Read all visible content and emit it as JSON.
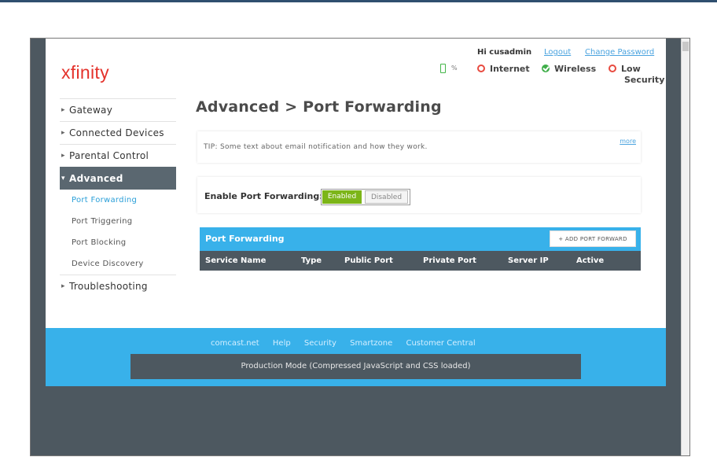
{
  "brand": {
    "logo": "xfinity",
    "accent": "#e4322b",
    "blue": "#38b1ea",
    "green": "#7cb518"
  },
  "header": {
    "greeting": "Hi cusadmin",
    "logout": "Logout",
    "change_password": "Change Password",
    "battery_pct": "%",
    "status": {
      "internet": "Internet",
      "wireless": "Wireless",
      "security_line1": "Low",
      "security_line2": "Security"
    }
  },
  "sidebar": {
    "items": [
      {
        "label": "Gateway"
      },
      {
        "label": "Connected Devices"
      },
      {
        "label": "Parental Control"
      },
      {
        "label": "Advanced"
      },
      {
        "label": "Troubleshooting"
      }
    ],
    "sub_items": [
      {
        "label": "Port Forwarding"
      },
      {
        "label": "Port Triggering"
      },
      {
        "label": "Port Blocking"
      },
      {
        "label": "Device Discovery"
      }
    ]
  },
  "main": {
    "title": "Advanced > Port Forwarding",
    "tip": "TIP: Some text about email notification and how they work.",
    "more": "more",
    "enable_label": "Enable Port Forwarding:",
    "toggle_on": "Enabled",
    "toggle_off": "Disabled",
    "panel_title": "Port Forwarding",
    "add_button": "+ ADD PORT FORWARD",
    "columns": [
      "Service Name",
      "Type",
      "Public Port",
      "Private Port",
      "Server IP",
      "Active"
    ]
  },
  "footer": {
    "links": [
      "comcast.net",
      "Help",
      "Security",
      "Smartzone",
      "Customer Central"
    ],
    "mode": "Production Mode (Compressed JavaScript and CSS loaded)"
  }
}
